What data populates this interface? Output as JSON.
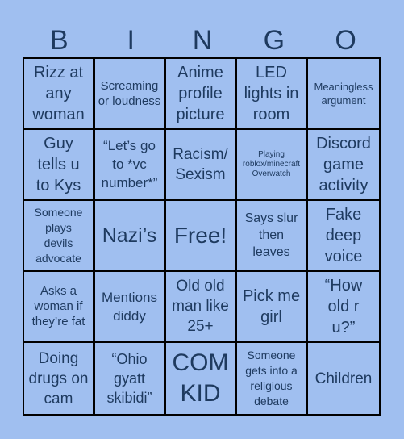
{
  "header": {
    "letters": [
      "B",
      "I",
      "N",
      "G",
      "O"
    ]
  },
  "board": {
    "cells": [
      "Rizz at any woman",
      "Screaming or loudness",
      "Anime profile picture",
      "LED lights in room",
      "Meaningless argument",
      "Guy tells u to Kys",
      "“Let’s go to *vc number*”",
      "Racism/ Sexism",
      "Playing roblox/minecraft Overwatch",
      "Discord game activity",
      "Someone plays devils advocate",
      "Nazi’s",
      "Free!",
      "Says slur then leaves",
      "Fake deep voice",
      "Asks a woman if they’re fat",
      "Mentions diddy",
      "Old old man like 25+",
      "Pick me girl",
      "“How old r u?”",
      "Doing drugs on cam",
      "“Ohio gyatt skibidi”",
      "COM KID",
      "Someone gets into a religious debate",
      "Children"
    ]
  },
  "colors": {
    "background": "#a0bff0",
    "text": "#1e3a5f",
    "grid_line": "#000000"
  }
}
